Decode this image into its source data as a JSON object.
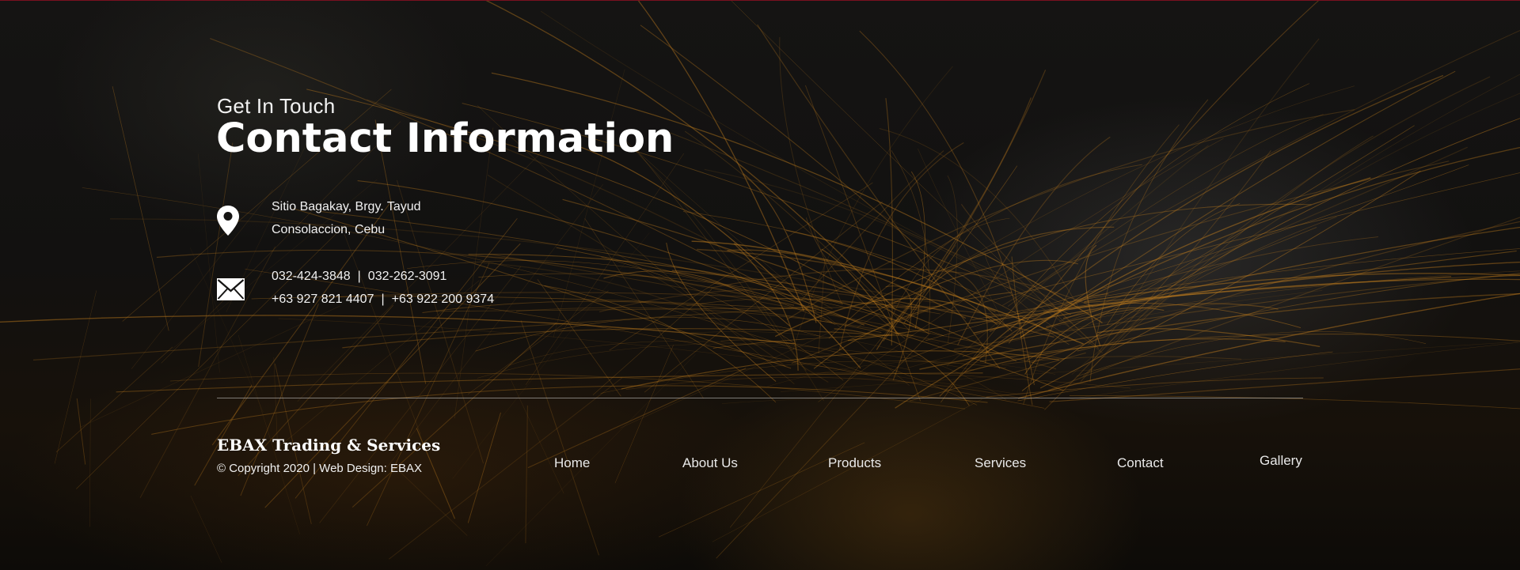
{
  "contact": {
    "subtitle": "Get In Touch",
    "title": "Contact Information",
    "address": {
      "icon": "map-pin-icon",
      "line1": "Sitio Bagakay, Brgy. Tayud",
      "line2": "Consolaccion, Cebu"
    },
    "phones": {
      "icon": "envelope-icon",
      "line1_a": "032-424-3848",
      "line1_b": "032-262-3091",
      "line2_a": "+63 927 821 4407",
      "line2_b": "+63 922 200 9374",
      "separator": "|"
    }
  },
  "footer": {
    "brand": "EBAX Trading & Services",
    "copyright": "© Copyright 2020 | Web Design: EBAX",
    "nav": {
      "home": "Home",
      "about": "About Us",
      "products": "Products",
      "services": "Services",
      "contact": "Contact",
      "gallery": "Gallery"
    }
  },
  "colors": {
    "background": "#121110",
    "text": "#ffffff",
    "accent_line": "#7a1020",
    "spark": "#c8811e"
  }
}
